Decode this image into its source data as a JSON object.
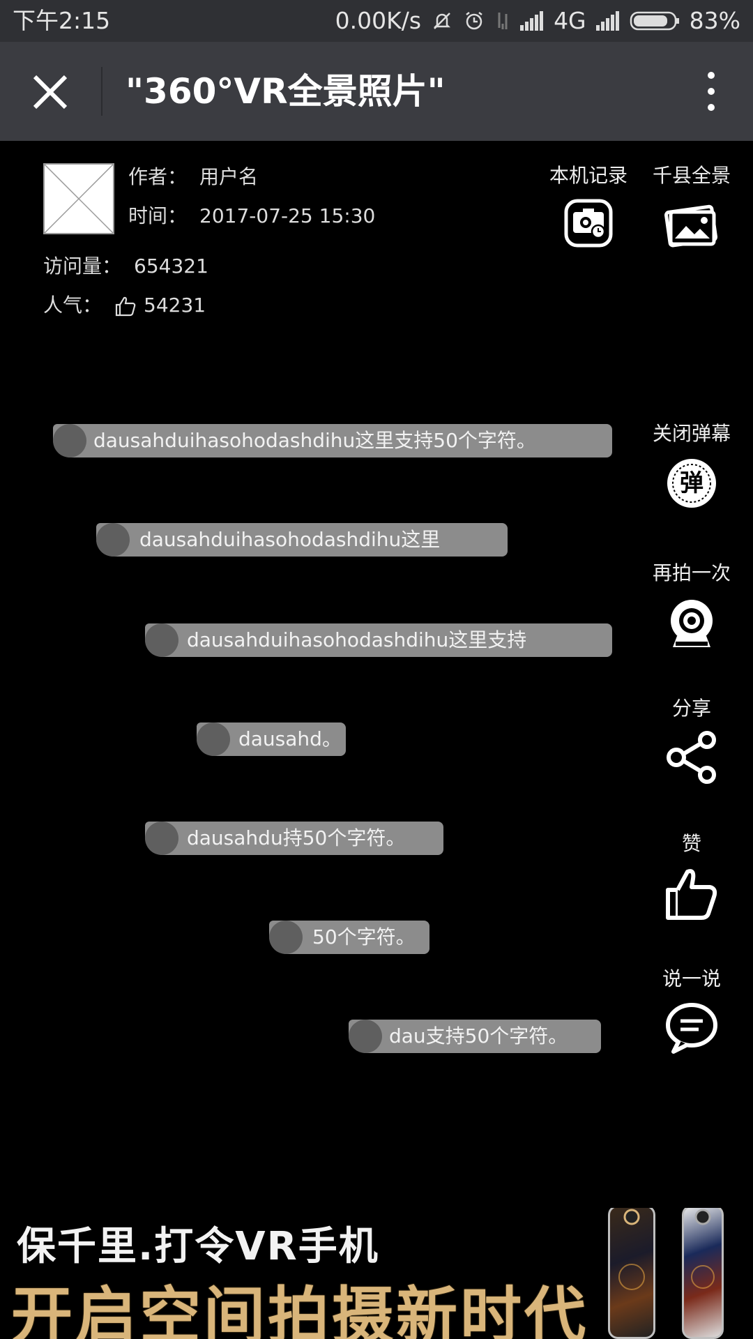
{
  "status_bar": {
    "time": "下午2:15",
    "speed": "0.00K/s",
    "network": "4G",
    "battery": "83%"
  },
  "title_bar": {
    "title": "\"360°VR全景照片\"",
    "close_icon": "close-icon",
    "more_icon": "more-vertical-icon"
  },
  "info": {
    "author_label": "作者：",
    "author_value": "用户名",
    "time_label": "时间：",
    "time_value": "2017-07-25 15:30",
    "views_label": "访问量：",
    "views_value": "654321",
    "popularity_label": "人气：",
    "popularity_value": "54231"
  },
  "tools_top": [
    {
      "label": "本机记录",
      "icon": "camera-record-icon"
    },
    {
      "label": "千县全景",
      "icon": "photo-gallery-icon"
    }
  ],
  "tools_side": [
    {
      "label": "关闭弹幕",
      "icon": "danmaku-icon"
    },
    {
      "label": "再拍一次",
      "icon": "webcam-icon"
    },
    {
      "label": "分享",
      "icon": "share-icon"
    },
    {
      "label": "赞",
      "icon": "thumbs-up-icon"
    },
    {
      "label": "说一说",
      "icon": "comment-icon"
    }
  ],
  "danmaku_icon_text": "弹",
  "danmaku": [
    "dausahduihasohodashdihu这里支持50个字符。",
    "dausahduihasohodashdihu这里",
    "dausahduihasohodashdihu这里支持",
    "dausahd。",
    "dausahdu持50个字符。",
    "50个字符。",
    "dau支持50个字符。"
  ],
  "banner": {
    "line1": "保千里.打令VR手机",
    "line2": "开启空间拍摄新时代",
    "colors": {
      "line2": "#d9b57a"
    }
  }
}
